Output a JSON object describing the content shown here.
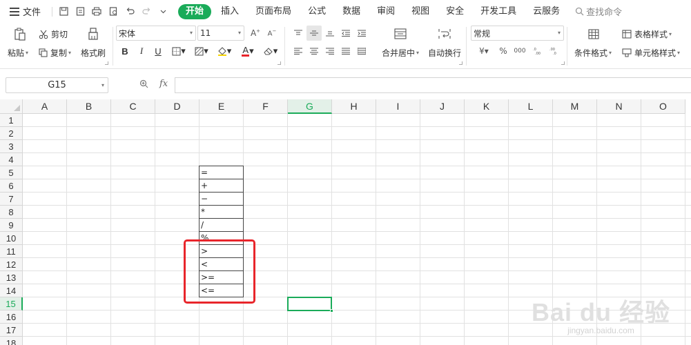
{
  "menubar": {
    "file_label": "文件",
    "tabs": [
      {
        "label": "开始",
        "active": true
      },
      {
        "label": "插入"
      },
      {
        "label": "页面布局"
      },
      {
        "label": "公式"
      },
      {
        "label": "数据"
      },
      {
        "label": "审阅"
      },
      {
        "label": "视图"
      },
      {
        "label": "安全"
      },
      {
        "label": "开发工具"
      },
      {
        "label": "云服务"
      }
    ],
    "search_label": "查找命令",
    "accent_color": "#1aab59"
  },
  "ribbon": {
    "clipboard": {
      "paste": "粘贴",
      "cut": "剪切",
      "copy": "复制",
      "format_painter": "格式刷"
    },
    "font": {
      "name": "宋体",
      "size": "11",
      "bold": "B",
      "italic": "I",
      "underline": "U",
      "font_color_letter": "A"
    },
    "alignment": {
      "merge_center": "合并居中",
      "wrap_text": "自动换行"
    },
    "number": {
      "format": "常规",
      "currency": "¥",
      "percent": "%",
      "thousands": "000"
    },
    "styles": {
      "conditional_format": "条件格式",
      "table_style": "表格样式",
      "cell_style": "单元格样式"
    }
  },
  "formula_bar": {
    "name_box": "G15",
    "fx_label": "fx",
    "formula": ""
  },
  "grid": {
    "columns": [
      "A",
      "B",
      "C",
      "D",
      "E",
      "F",
      "G",
      "H",
      "I",
      "J",
      "K",
      "L",
      "M",
      "N",
      "O"
    ],
    "rows": [
      "1",
      "2",
      "3",
      "4",
      "5",
      "6",
      "7",
      "8",
      "9",
      "10",
      "11",
      "12",
      "13",
      "14",
      "15",
      "16",
      "17",
      "18"
    ],
    "selected_column": "G",
    "selected_row": "15",
    "column_e_cells": [
      {
        "row": "5",
        "value": "="
      },
      {
        "row": "6",
        "value": "+"
      },
      {
        "row": "7",
        "value": "−"
      },
      {
        "row": "8",
        "value": "*"
      },
      {
        "row": "9",
        "value": "/"
      },
      {
        "row": "10",
        "value": "%"
      },
      {
        "row": "11",
        "value": ">"
      },
      {
        "row": "12",
        "value": "<"
      },
      {
        "row": "13",
        "value": ">="
      },
      {
        "row": "14",
        "value": "<="
      }
    ],
    "highlight_color": "#e8252b"
  },
  "watermark": {
    "brand": "Bai du 经验",
    "url": "jingyan.baidu.com"
  }
}
